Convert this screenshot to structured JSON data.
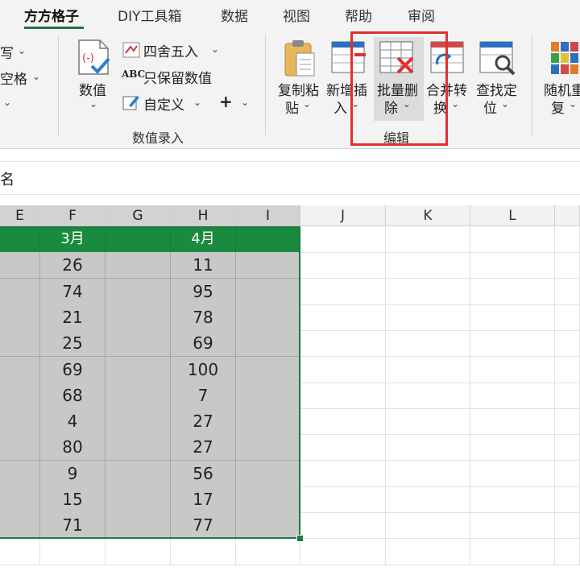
{
  "menus": [
    "方方格子",
    "DIY工具箱",
    "数据",
    "视图",
    "帮助",
    "审阅"
  ],
  "ribbon": {
    "left_partial": [
      "写",
      "空格",
      ""
    ],
    "numeric": {
      "big_label": "数值",
      "round_label": "四舍五入",
      "keep_label": "只保留数值",
      "custom_label": "自定义",
      "plus": "+"
    },
    "group_numeric_label": "数值录入",
    "tools": [
      {
        "line1": "复制粘",
        "line2": "贴",
        "icon": "paste-icon"
      },
      {
        "line1": "新增插",
        "line2": "入",
        "icon": "insert-icon"
      },
      {
        "line1": "批量删",
        "line2": "除",
        "icon": "batch-delete-icon"
      },
      {
        "line1": "合并转",
        "line2": "换",
        "icon": "merge-convert-icon"
      },
      {
        "line1": "查找定",
        "line2": "位",
        "icon": "find-locate-icon"
      },
      {
        "line1": "随机重",
        "line2": "复",
        "icon": "random-repeat-icon"
      }
    ],
    "group_edit_label": "编辑"
  },
  "formula_bar": {
    "name_fragment": "名"
  },
  "columns": [
    "E",
    "F",
    "G",
    "H",
    "I",
    "J",
    "K",
    "L"
  ],
  "table": {
    "header": [
      "",
      "3月",
      "",
      "4月",
      ""
    ],
    "rows": [
      [
        "",
        "26",
        "",
        "11",
        ""
      ],
      [
        "",
        "74",
        "",
        "95",
        ""
      ],
      [
        "",
        "21",
        "",
        "78",
        ""
      ],
      [
        "",
        "25",
        "",
        "69",
        ""
      ],
      [
        "",
        "69",
        "",
        "100",
        ""
      ],
      [
        "",
        "68",
        "",
        "7",
        ""
      ],
      [
        "",
        "4",
        "",
        "27",
        ""
      ],
      [
        "",
        "80",
        "",
        "27",
        ""
      ],
      [
        "",
        "9",
        "",
        "56",
        ""
      ],
      [
        "",
        "15",
        "",
        "17",
        ""
      ],
      [
        "",
        "71",
        "",
        "77",
        ""
      ]
    ]
  },
  "colors": {
    "accent": "#217346",
    "header_fill": "#1a8a3e",
    "selection": "#c8c8c8",
    "highlight_box": "#e03030"
  }
}
